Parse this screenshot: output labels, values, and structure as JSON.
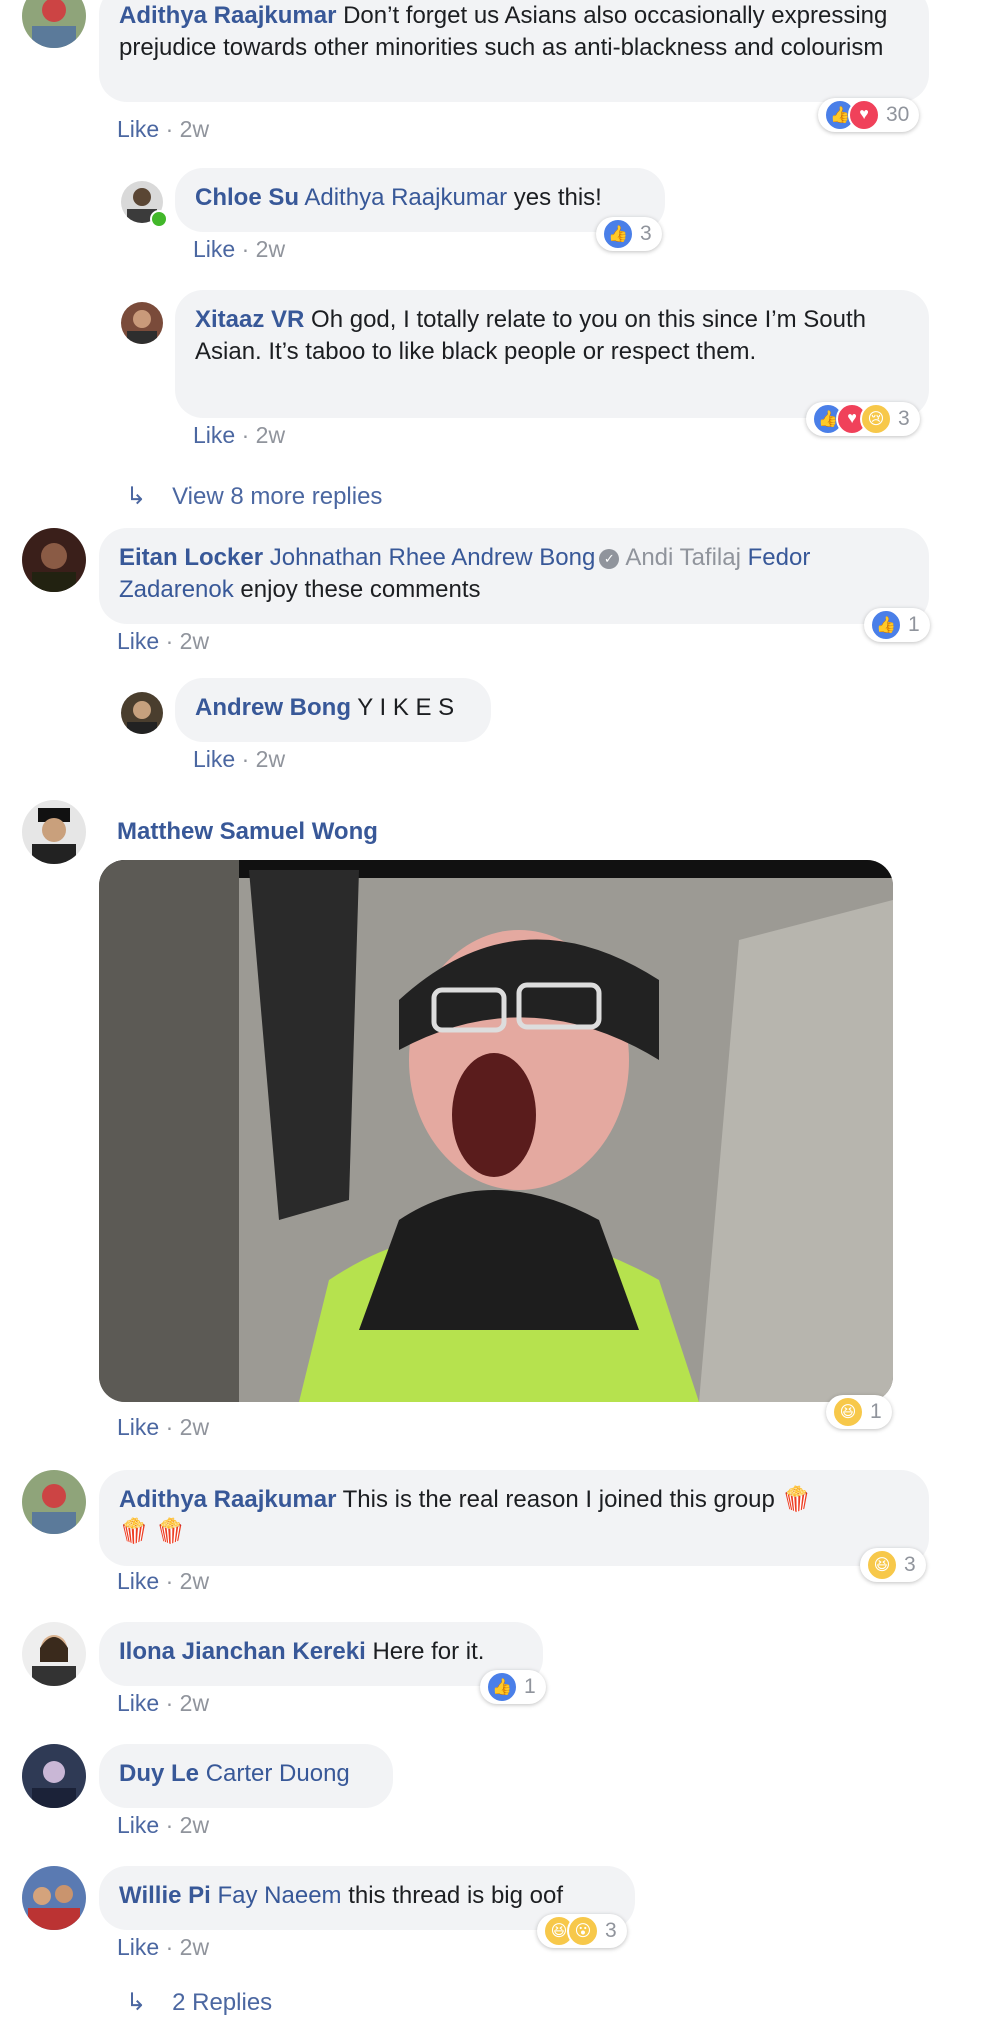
{
  "comments": [
    {
      "author": "Adithya Raajkumar",
      "text": "Don’t forget us Asians also occasionally expressing prejudice towards other minorities such as anti-blackness and colourism",
      "like": "Like",
      "time": "2w",
      "reactions": "30"
    },
    {
      "author": "Chloe Su",
      "mention": "Adithya Raajkumar",
      "text": "yes this!",
      "like": "Like",
      "time": "2w",
      "reactions": "3"
    },
    {
      "author": "Xitaaz VR",
      "text": "Oh god, I totally relate to you on this since I’m South Asian. It’s taboo to like black people or respect them.",
      "like": "Like",
      "time": "2w",
      "reactions": "3"
    },
    {
      "view_more": "View 8 more replies"
    },
    {
      "author": "Eitan Locker",
      "mentions": [
        "Johnathan Rhee",
        "Andrew Bong",
        "Andi Tafilaj",
        "Fedor Zadarenok"
      ],
      "text": "enjoy these comments",
      "like": "Like",
      "time": "2w",
      "reactions": "1"
    },
    {
      "author": "Andrew Bong",
      "text": "Y I K E S",
      "like": "Like",
      "time": "2w"
    },
    {
      "author": "Matthew Samuel Wong",
      "like": "Like",
      "time": "2w",
      "reactions": "1"
    },
    {
      "author": "Adithya Raajkumar",
      "text": "This is the real reason I joined this group",
      "like": "Like",
      "time": "2w",
      "reactions": "3"
    },
    {
      "author": "Ilona Jianchan Kereki",
      "text": "Here for it.",
      "like": "Like",
      "time": "2w",
      "reactions": "1"
    },
    {
      "author": "Duy Le",
      "mention": "Carter Duong",
      "like": "Like",
      "time": "2w"
    },
    {
      "author": "Willie Pi",
      "mention": "Fay Naeem",
      "text": "this thread is big oof",
      "like": "Like",
      "time": "2w",
      "reactions": "3"
    },
    {
      "view_more": "2 Replies"
    }
  ],
  "meta_sep": " · ",
  "icons": {
    "like": "thumbs-up-icon",
    "love": "heart-icon",
    "haha": "laughing-face-icon",
    "wow": "surprised-face-icon",
    "sad": "sad-face-icon",
    "reply_arrow": "reply-arrow-icon",
    "popcorn": "popcorn-icon"
  },
  "colors": {
    "bubble": "#f2f3f5",
    "name": "#385898",
    "muted": "#90949c",
    "like_reaction": "#4a7fe8",
    "love_reaction": "#f0415a",
    "emoji_reaction": "#f7c84a"
  }
}
